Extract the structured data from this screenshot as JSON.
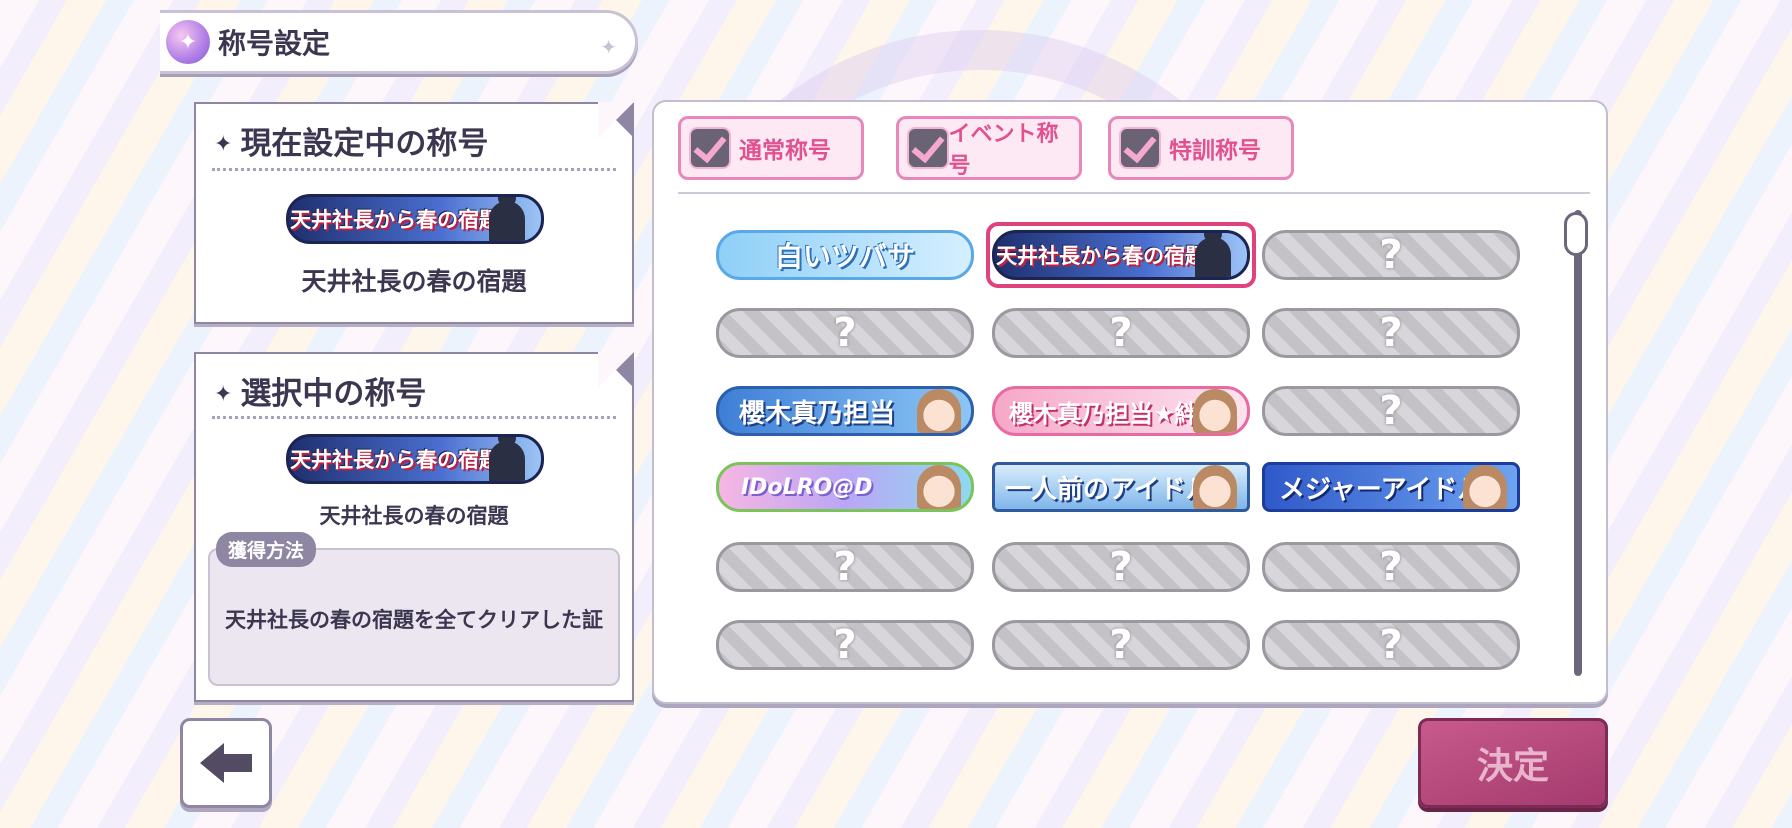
{
  "header": {
    "title": "称号設定"
  },
  "current": {
    "heading": "現在設定中の称号",
    "title_name": "天井社長の春の宿題"
  },
  "selected": {
    "heading": "選択中の称号",
    "title_name": "天井社長の春の宿題",
    "acquisition_label": "獲得方法",
    "acquisition_text": "天井社長の春の宿題を全てクリアした証"
  },
  "badges": {
    "tenjo": "天井社長から春の宿題",
    "wings": "白いツバサ",
    "sakuragi": "櫻木真乃担当",
    "sakuragi_kizuna": "櫻木真乃担当★絆",
    "idol_road": "IDoLRO@D",
    "ichininmae": "一人前のアイドル",
    "major": "メジャーアイドル",
    "locked": "?"
  },
  "filters": [
    {
      "label": "通常称号",
      "checked": true
    },
    {
      "label": "イベント称号",
      "checked": true
    },
    {
      "label": "特訓称号",
      "checked": true
    }
  ],
  "buttons": {
    "confirm": "決定"
  },
  "colors": {
    "accent_pink": "#e0427e",
    "panel_border": "#8f86a3",
    "confirm_bg": "#b34a7d"
  }
}
